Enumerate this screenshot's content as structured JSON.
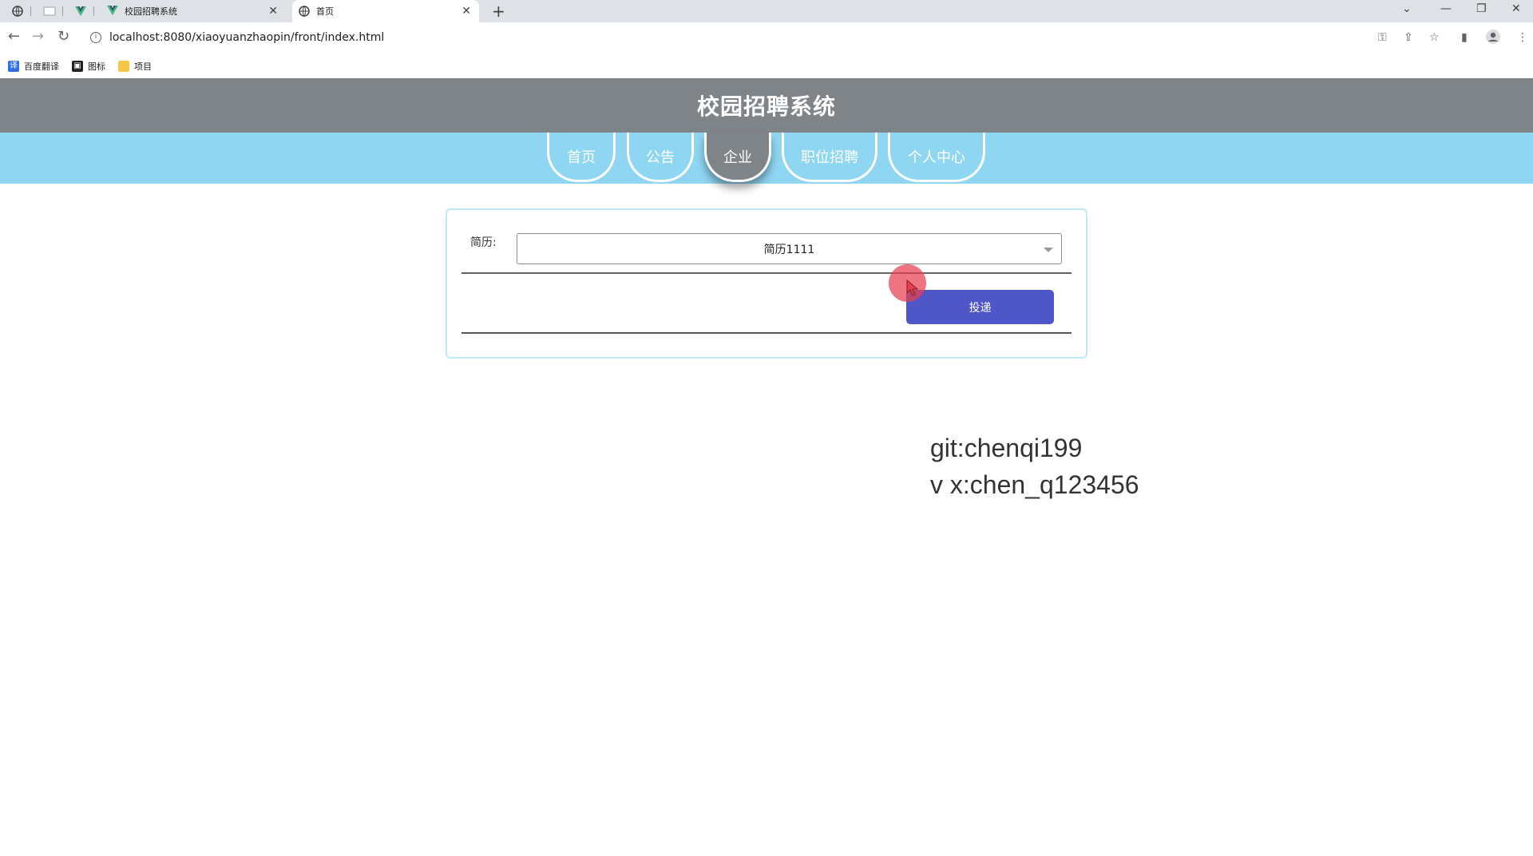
{
  "browser": {
    "tabs": [
      {
        "title": "校园招聘系统",
        "active": false
      },
      {
        "title": "首页",
        "active": true
      }
    ],
    "url": "localhost:8080/xiaoyuanzhaopin/front/index.html",
    "bookmarks": [
      "百度翻译",
      "图标",
      "项目"
    ]
  },
  "site": {
    "title": "校园招聘系统",
    "nav": [
      "首页",
      "公告",
      "企业",
      "职位招聘",
      "个人中心"
    ],
    "active_nav": "企业"
  },
  "form": {
    "resume_label": "简历:",
    "resume_selected": "简历1111",
    "submit_label": "投递"
  },
  "watermark": {
    "line1": "git:chenqi199",
    "line2": "v x:chen_q123456"
  },
  "colors": {
    "header_bg": "#7f8488",
    "nav_bg": "#8fd6f2",
    "submit_bg": "#4f56c8"
  }
}
